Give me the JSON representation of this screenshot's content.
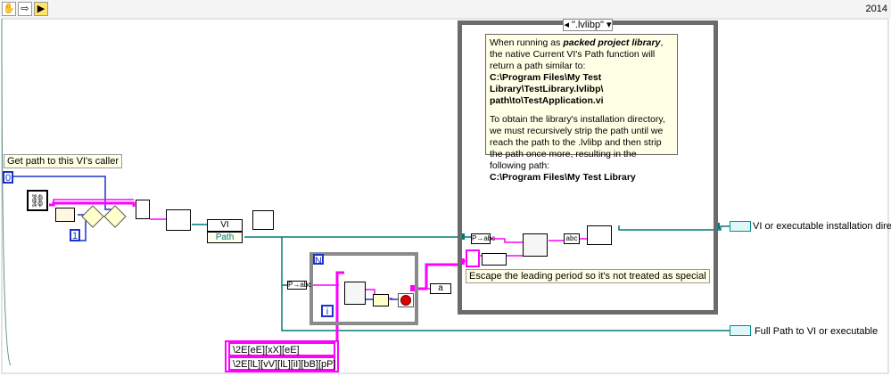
{
  "version": "2014",
  "toolbar": {
    "run_icon": "hand-icon",
    "arrow_icon": "arrow-icon",
    "highlight_icon": "bulb-icon"
  },
  "labels": {
    "get_path": "Get path to this VI's caller",
    "escape_period": "Escape the leading period so it's not treated as special",
    "vi_or_exe_install": "VI or executable installation directory",
    "full_path": "Full Path to VI or executable"
  },
  "constants": {
    "zero": "0",
    "one": "1",
    "regex1": "\\2E[eE][xX][eE]",
    "regex2": "\\2E[lL][vV][lL][iI][bB][pP]",
    "loop_index": "i",
    "loop_count": "N",
    "path_label": "Path",
    "vi_label": "VI",
    "case_a": "a"
  },
  "case_structure": {
    "selector": "\".lvlibp\""
  },
  "comment": {
    "line1_a": "When running as ",
    "line1_b": "packed project library",
    "line1_c": ", the native Current VI's Path function will return a path similar to:",
    "path_example_1": "C:\\Program Files\\My Test Library\\TestLibrary.lvlibp\\",
    "path_example_2": "path\\to\\TestApplication.vi",
    "para2": "To obtain the library's installation directory, we must recursively strip the path until we reach the path to the .lvlibp and then strip the path once more, resulting in the following path:",
    "result_path": "C:\\Program Files\\My Test Library"
  },
  "colors": {
    "path_wire": "#007878",
    "string_wire": "#ff00ff",
    "numeric_wire": "#1c32c8",
    "frame": "#6b6b6b"
  }
}
